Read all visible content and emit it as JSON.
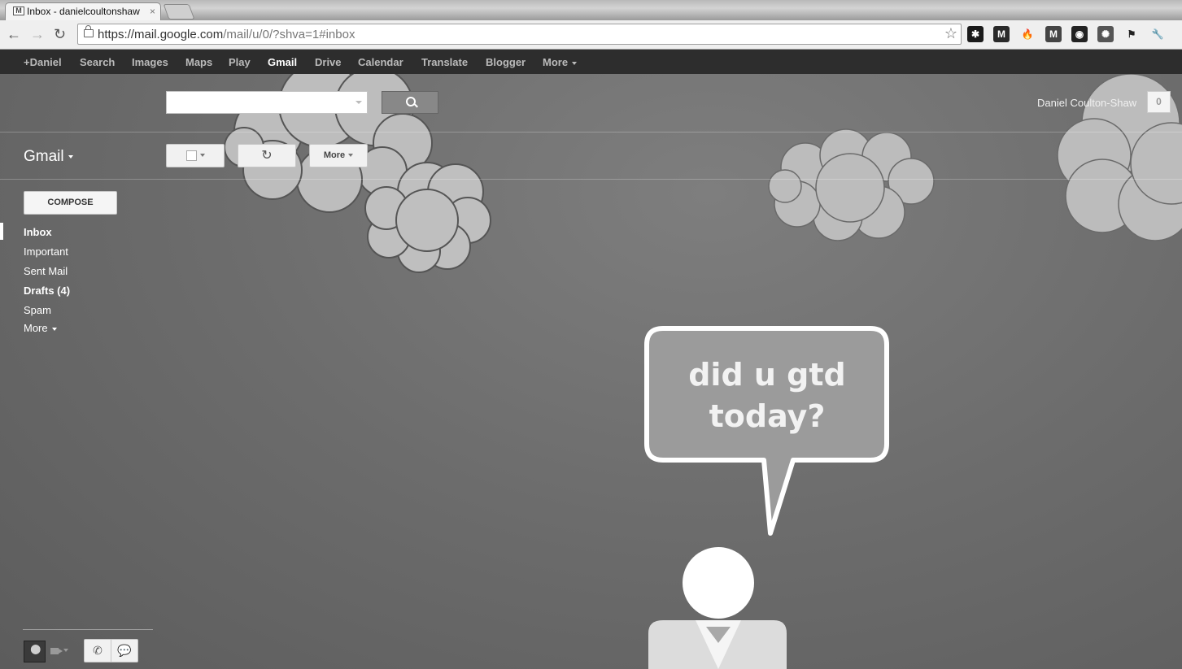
{
  "browser": {
    "tab_title": "Inbox - danielcoultonshaw",
    "tab_close": "×",
    "favicon": "M",
    "url_host": "https://mail.google.com",
    "url_path": "/mail/u/0/?shva=1#inbox",
    "back_glyph": "←",
    "forward_glyph": "→",
    "reload_glyph": "↻",
    "star_glyph": "☆",
    "extensions": [
      {
        "icon": "asterisk-icon",
        "glyph": "✱",
        "color": "#1a1a1a"
      },
      {
        "icon": "m-square-icon",
        "glyph": "M",
        "color": "#2a2a2a"
      },
      {
        "icon": "flame-icon",
        "glyph": "🔥",
        "color": "#efefef"
      },
      {
        "icon": "m-badge-icon",
        "glyph": "M",
        "color": "#444444"
      },
      {
        "icon": "camera-icon",
        "glyph": "◉",
        "color": "#222222"
      },
      {
        "icon": "gear-badge-icon",
        "glyph": "✺",
        "color": "#555555"
      },
      {
        "icon": "flag-icon",
        "glyph": "⚑",
        "color": "#efefef"
      },
      {
        "icon": "wrench-icon",
        "glyph": "🔧",
        "color": "#efefef"
      }
    ]
  },
  "gbar": {
    "items": [
      {
        "label": "+Daniel",
        "active": false
      },
      {
        "label": "Search",
        "active": false
      },
      {
        "label": "Images",
        "active": false
      },
      {
        "label": "Maps",
        "active": false
      },
      {
        "label": "Play",
        "active": false
      },
      {
        "label": "Gmail",
        "active": true
      },
      {
        "label": "Drive",
        "active": false
      },
      {
        "label": "Calendar",
        "active": false
      },
      {
        "label": "Translate",
        "active": false
      },
      {
        "label": "Blogger",
        "active": false
      },
      {
        "label": "More",
        "active": false
      }
    ]
  },
  "header": {
    "search_value": "",
    "user_name": "Daniel Coulton-Shaw",
    "notification_count": "0"
  },
  "toolbar": {
    "gmail_label": "Gmail",
    "more_label": "More",
    "refresh_glyph": "↻"
  },
  "sidebar": {
    "compose_label": "COMPOSE",
    "items": [
      {
        "label": "Inbox",
        "bold": true,
        "selected": true
      },
      {
        "label": "Important",
        "bold": false,
        "selected": false
      },
      {
        "label": "Sent Mail",
        "bold": false,
        "selected": false
      },
      {
        "label": "Drafts (4)",
        "bold": true,
        "selected": false
      },
      {
        "label": "Spam",
        "bold": false,
        "selected": false
      }
    ],
    "more_label": "More"
  },
  "chat": {
    "phone_glyph": "✆",
    "chat_glyph": "💬"
  },
  "theme": {
    "speech_line1": "did u gtd",
    "speech_line2": "today?"
  }
}
